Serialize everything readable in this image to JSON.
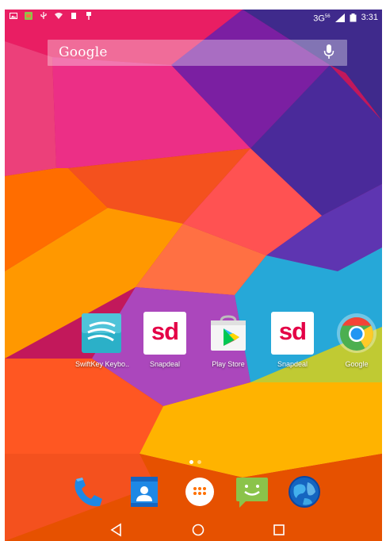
{
  "status_bar": {
    "network": "3G",
    "network_sup": "56",
    "time": "3:31"
  },
  "search_bar": {
    "logo_text": "Google"
  },
  "apps": [
    {
      "label": "SwiftKey Keybo..",
      "icon": "swiftkey-icon"
    },
    {
      "label": "Snapdeal",
      "icon_text": "sd",
      "icon": "snapdeal-icon"
    },
    {
      "label": "Play Store",
      "icon": "play-store-icon"
    },
    {
      "label": "Snapdeal",
      "icon_text": "sd",
      "icon": "snapdeal-icon"
    },
    {
      "label": "Google",
      "icon": "chrome-icon"
    }
  ],
  "dock": [
    "phone-icon",
    "contacts-icon",
    "app-drawer-icon",
    "messaging-icon",
    "browser-icon"
  ],
  "nav": [
    "back-icon",
    "home-icon",
    "recents-icon"
  ],
  "colors": {
    "snapdeal_red": "#e40046",
    "swiftkey_teal": "#2bb0c8",
    "play_store_bag": "#f5f5f5"
  }
}
